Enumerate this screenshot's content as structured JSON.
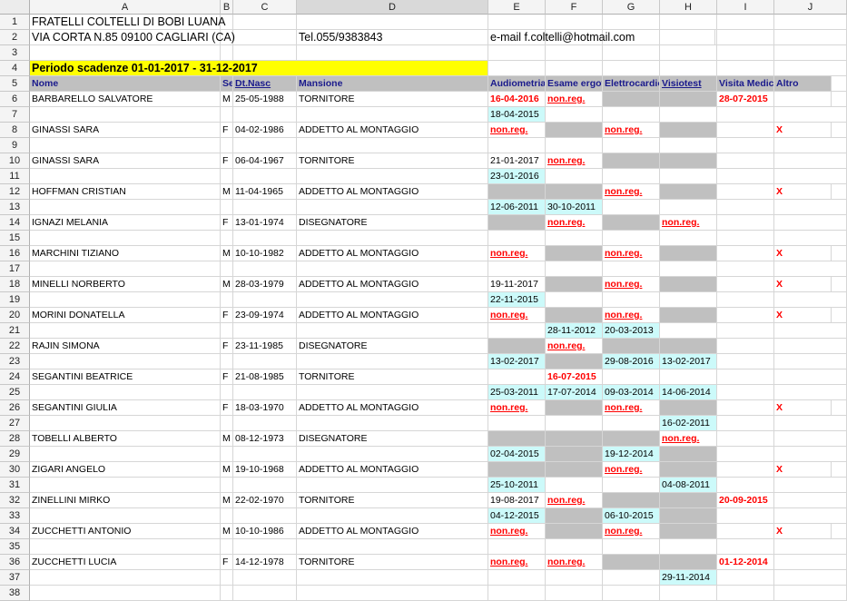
{
  "columns": [
    "A",
    "B",
    "C",
    "D",
    "E",
    "F",
    "G",
    "H",
    "I",
    "J"
  ],
  "selected_column": "D",
  "row_numbers": [
    "1",
    "2",
    "3",
    "4",
    "5",
    "6",
    "7",
    "8",
    "9",
    "10",
    "11",
    "12",
    "13",
    "14",
    "15",
    "16",
    "17",
    "18",
    "19",
    "20",
    "21",
    "22",
    "23",
    "24",
    "25",
    "26",
    "27",
    "28",
    "29",
    "30",
    "31",
    "32",
    "33",
    "34",
    "35",
    "36",
    "37",
    "38"
  ],
  "company": {
    "name": "FRATELLI COLTELLI DI BOBI LUANA",
    "address": "VIA CORTA  N.85 09100 CAGLIARI (CA)",
    "phone": "Tel.055/9383843",
    "email": "e-mail f.coltelli@hotmail.com"
  },
  "period": "Periodo scadenze 01-01-2017  - 31-12-2017",
  "headers": {
    "nome": "Nome",
    "sesso": "Sesso",
    "dtnasc": "Dt.Nasc",
    "mansione": "Mansione",
    "audiometria": "Audiometria",
    "esame": "Esame ergovision",
    "elettro": "Elettrocardiogramma",
    "visio": "Visiotest",
    "visita": "Visita Medica",
    "altro": "Altro"
  },
  "status_text": "non.reg.",
  "x_mark": "X",
  "colors": {
    "cyan": "#ccfafa",
    "grey": "#c0c0c0",
    "yellow": "#ffff00",
    "red": "#ff0000",
    "header_text": "#1a1a8c"
  },
  "rows": [
    {
      "r": 6,
      "A": "BARBARELLO SALVATORE",
      "B": "M",
      "C": "25-05-1988",
      "D": "TORNITORE",
      "E": "16-04-2016",
      "F": "non.reg.",
      "G": "",
      "H": "",
      "I": "28-07-2015",
      "J": ""
    },
    {
      "r": 7,
      "E": "18-04-2015"
    },
    {
      "r": 8,
      "A": "GINASSI SARA",
      "B": "F",
      "C": "04-02-1986",
      "D": "ADDETTO AL MONTAGGIO",
      "E": "non.reg.",
      "F": "",
      "G": "non.reg.",
      "H": "",
      "I": "",
      "J": "X"
    },
    {
      "r": 10,
      "A": "GINASSI SARA",
      "B": "F",
      "C": "06-04-1967",
      "D": "TORNITORE",
      "E": "21-01-2017",
      "F": "non.reg.",
      "G": "",
      "H": ""
    },
    {
      "r": 11,
      "E": "23-01-2016"
    },
    {
      "r": 12,
      "A": "HOFFMAN CRISTIAN",
      "B": "M",
      "C": "11-04-1965",
      "D": "ADDETTO AL MONTAGGIO",
      "E": "",
      "F": "",
      "G": "non.reg.",
      "H": "",
      "J": "X"
    },
    {
      "r": 13,
      "E": "12-06-2011",
      "F": "30-10-2011"
    },
    {
      "r": 14,
      "A": "IGNAZI MELANIA",
      "B": "F",
      "C": "13-01-1974",
      "D": "DISEGNATORE",
      "E": "",
      "F": "non.reg.",
      "G": "",
      "H": "non.reg."
    },
    {
      "r": 16,
      "A": "MARCHINI TIZIANO",
      "B": "M",
      "C": "10-10-1982",
      "D": "ADDETTO AL MONTAGGIO",
      "E": "non.reg.",
      "F": "",
      "G": "non.reg.",
      "H": "",
      "J": "X"
    },
    {
      "r": 18,
      "A": "MINELLI NORBERTO",
      "B": "M",
      "C": "28-03-1979",
      "D": "ADDETTO AL MONTAGGIO",
      "E": "19-11-2017",
      "F": "",
      "G": "non.reg.",
      "H": "",
      "J": "X"
    },
    {
      "r": 19,
      "E": "22-11-2015"
    },
    {
      "r": 20,
      "A": "MORINI DONATELLA",
      "B": "F",
      "C": "23-09-1974",
      "D": "ADDETTO AL MONTAGGIO",
      "E": "non.reg.",
      "F": "",
      "G": "non.reg.",
      "H": "",
      "J": "X"
    },
    {
      "r": 21,
      "F": "28-11-2012",
      "G": "20-03-2013"
    },
    {
      "r": 22,
      "A": "RAJIN SIMONA",
      "B": "F",
      "C": "23-11-1985",
      "D": "DISEGNATORE",
      "E": "",
      "F": "non.reg.",
      "G": "",
      "H": ""
    },
    {
      "r": 23,
      "E": "13-02-2017",
      "G": "29-08-2016",
      "H": "13-02-2017"
    },
    {
      "r": 24,
      "A": "SEGANTINI BEATRICE",
      "B": "F",
      "C": "21-08-1985",
      "D": "TORNITORE",
      "F": "16-07-2015"
    },
    {
      "r": 25,
      "E": "25-03-2011",
      "F": "17-07-2014",
      "G": "09-03-2014",
      "H": "14-06-2014"
    },
    {
      "r": 26,
      "A": "SEGANTINI GIULIA",
      "B": "F",
      "C": "18-03-1970",
      "D": "ADDETTO AL MONTAGGIO",
      "E": "non.reg.",
      "F": "",
      "G": "non.reg.",
      "H": "",
      "J": "X"
    },
    {
      "r": 27,
      "H": "16-02-2011"
    },
    {
      "r": 28,
      "A": "TOBELLI ALBERTO",
      "B": "M",
      "C": "08-12-1973",
      "D": "DISEGNATORE",
      "E": "",
      "F": "",
      "G": "",
      "H": "non.reg."
    },
    {
      "r": 29,
      "E": "02-04-2015",
      "G": "19-12-2014"
    },
    {
      "r": 30,
      "A": "ZIGARI ANGELO",
      "B": "M",
      "C": "19-10-1968",
      "D": "ADDETTO AL MONTAGGIO",
      "E": "",
      "F": "",
      "G": "non.reg.",
      "H": "",
      "J": "X"
    },
    {
      "r": 31,
      "E": "25-10-2011",
      "H": "04-08-2011"
    },
    {
      "r": 32,
      "A": "ZINELLINI MIRKO",
      "B": "M",
      "C": "22-02-1970",
      "D": "TORNITORE",
      "E": "19-08-2017",
      "F": "non.reg.",
      "G": "",
      "H": "",
      "I": "20-09-2015"
    },
    {
      "r": 33,
      "E": "04-12-2015",
      "G": "06-10-2015"
    },
    {
      "r": 34,
      "A": "ZUCCHETTI ANTONIO",
      "B": "M",
      "C": "10-10-1986",
      "D": "ADDETTO AL MONTAGGIO",
      "E": "non.reg.",
      "F": "",
      "G": "non.reg.",
      "H": "",
      "J": "X"
    },
    {
      "r": 36,
      "A": "ZUCCHETTI LUCIA",
      "B": "F",
      "C": "14-12-1978",
      "D": "TORNITORE",
      "E": "non.reg.",
      "F": "non.reg.",
      "G": "",
      "H": "",
      "I": "01-12-2014"
    },
    {
      "r": 37,
      "H": "29-11-2014"
    }
  ]
}
